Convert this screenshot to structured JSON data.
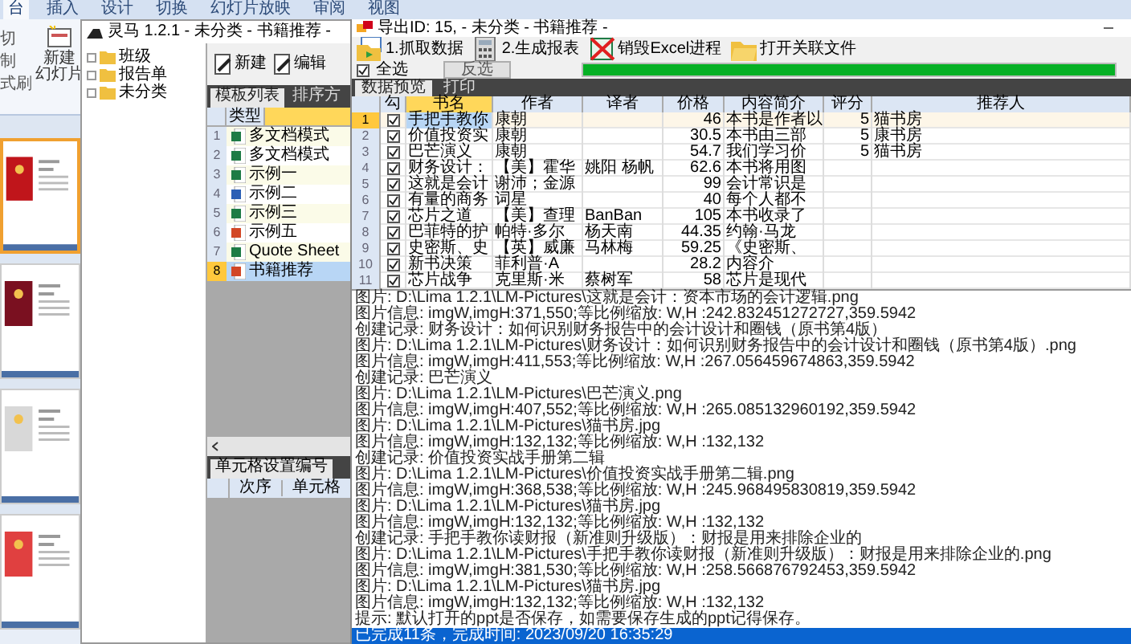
{
  "background_app": {
    "tabs": [
      {
        "label": "台",
        "selected": true
      },
      {
        "label": "插入",
        "selected": false
      },
      {
        "label": "设计",
        "selected": false
      },
      {
        "label": "切换",
        "selected": false
      },
      {
        "label": "幻灯片放映",
        "selected": false
      },
      {
        "label": "审阅",
        "selected": false
      },
      {
        "label": "视图",
        "selected": false
      }
    ],
    "clipboard": [
      "切",
      "制",
      "式刷"
    ],
    "new_slide": [
      "新建",
      "幻灯片"
    ],
    "slides": [
      {
        "kind": "picture",
        "selected": true
      },
      {
        "kind": "picture",
        "selected": false
      },
      {
        "kind": "picture",
        "selected": false
      },
      {
        "kind": "picture",
        "selected": false
      }
    ]
  },
  "main_window": {
    "title": "灵马 1.2.1 - 未分类 - 书籍推荐 -",
    "tree": [
      {
        "label": "班级"
      },
      {
        "label": "报告单"
      },
      {
        "label": "未分类"
      }
    ],
    "toolbar": [
      "新建",
      "编辑"
    ],
    "tabs": [
      {
        "label": "模板列表",
        "selected": true
      },
      {
        "label": "排序方",
        "selected": false
      }
    ],
    "templates": {
      "columns": [
        "类型"
      ],
      "rows": [
        {
          "number": "1",
          "kind": "excel",
          "name": "多文档模式",
          "selected": false
        },
        {
          "number": "2",
          "kind": "excel",
          "name": "多文档模式",
          "selected": false
        },
        {
          "number": "3",
          "kind": "excel",
          "name": "示例一",
          "selected": false
        },
        {
          "number": "4",
          "kind": "word",
          "name": "示例二",
          "selected": false
        },
        {
          "number": "5",
          "kind": "excel",
          "name": "示例三",
          "selected": false
        },
        {
          "number": "6",
          "kind": "ppt",
          "name": "示例五",
          "selected": false
        },
        {
          "number": "7",
          "kind": "excel",
          "name": "Quote Sheet",
          "selected": false
        },
        {
          "number": "8",
          "kind": "ppt",
          "name": "书籍推荐",
          "selected": true
        }
      ]
    },
    "cell_panel": {
      "tab": "单元格设置编号",
      "columns": [
        "次序",
        "单元格"
      ]
    }
  },
  "export_window": {
    "title": "导出ID: 15, - 未分类 - 书籍推荐 -",
    "toolbar": [
      {
        "kind": "fetch",
        "label": "1.抓取数据"
      },
      {
        "kind": "report",
        "label": "2.生成报表"
      },
      {
        "kind": "kill",
        "label": "销毁Excel进程"
      },
      {
        "kind": "folder",
        "label": "打开关联文件"
      }
    ],
    "select_all": {
      "label": "全选",
      "checked": true
    },
    "invert_button": "反选",
    "progress": {
      "level": 1
    },
    "tabs": [
      {
        "label": "数据预览",
        "selected": true
      },
      {
        "label": "打印",
        "selected": false
      }
    ],
    "table": {
      "columns": [
        "勾",
        "书名",
        "作者",
        "译者",
        "价格",
        "内容简介",
        "评分",
        "推荐人"
      ],
      "rows": [
        {
          "number": "1",
          "checked": true,
          "selected": true,
          "cells": [
            "",
            "手把手教你",
            "康朝",
            "",
            "46",
            "本书是作者以",
            "5",
            "猫书房"
          ]
        },
        {
          "number": "2",
          "checked": true,
          "selected": false,
          "cells": [
            "",
            "价值投资实",
            "康朝",
            "",
            "30.5",
            "本书由三部",
            "5",
            "康书房"
          ]
        },
        {
          "number": "3",
          "checked": true,
          "selected": false,
          "cells": [
            "",
            "巴芒演义",
            "康朝",
            "",
            "54.7",
            "我们学习价",
            "5",
            "猫书房"
          ]
        },
        {
          "number": "4",
          "checked": true,
          "selected": false,
          "cells": [
            "",
            "财务设计：",
            "【美】霍华",
            "姚阳 杨帆",
            "62.6",
            "本书将用图",
            "",
            ""
          ]
        },
        {
          "number": "5",
          "checked": true,
          "selected": false,
          "cells": [
            "",
            "这就是会计",
            "谢沛；金源",
            "",
            "99",
            "会计常识是",
            "",
            ""
          ]
        },
        {
          "number": "6",
          "checked": true,
          "selected": false,
          "cells": [
            "",
            "有量的商务",
            "词星",
            "",
            "40",
            "每个人都不",
            "",
            ""
          ]
        },
        {
          "number": "7",
          "checked": true,
          "selected": false,
          "cells": [
            "",
            "芯片之道",
            "【美】查理",
            "BanBan",
            "105",
            "本书收录了",
            "",
            ""
          ]
        },
        {
          "number": "8",
          "checked": true,
          "selected": false,
          "cells": [
            "",
            "巴菲特的护",
            "帕特·多尔",
            "杨天南",
            "44.35",
            "约翰·马龙",
            "",
            ""
          ]
        },
        {
          "number": "9",
          "checked": true,
          "selected": false,
          "cells": [
            "",
            "史密斯、史",
            "【英】威廉",
            "马林梅",
            "59.25",
            "《史密斯、",
            "",
            ""
          ]
        },
        {
          "number": "10",
          "checked": true,
          "selected": false,
          "cells": [
            "",
            "新书决策",
            "菲利普·A",
            "",
            "28.2",
            "内容介",
            "",
            ""
          ]
        },
        {
          "number": "11",
          "checked": true,
          "selected": false,
          "cells": [
            "",
            "芯片战争",
            "克里斯·米",
            "蔡树军",
            "58",
            "芯片是现代",
            "",
            ""
          ]
        }
      ]
    },
    "log": [
      "图片: D:\\Lima 1.2.1\\LM-Pictures\\这就是会计：资本市场的会计逻辑.png",
      "图片信息: imgW,imgH:371,550;等比例缩放: W,H :242.832451272727,359.5942",
      "创建记录: 财务设计：如何识别财务报告中的会计设计和圈钱（原书第4版）",
      "图片: D:\\Lima 1.2.1\\LM-Pictures\\财务设计：如何识别财务报告中的会计设计和圈钱（原书第4版）.png",
      "图片信息: imgW,imgH:411,553;等比例缩放: W,H :267.056459674863,359.5942",
      "创建记录: 巴芒演义",
      "图片: D:\\Lima 1.2.1\\LM-Pictures\\巴芒演义.png",
      "图片信息: imgW,imgH:407,552;等比例缩放: W,H :265.085132960192,359.5942",
      "图片: D:\\Lima 1.2.1\\LM-Pictures\\猫书房.jpg",
      "图片信息: imgW,imgH:132,132;等比例缩放: W,H :132,132",
      "创建记录: 价值投资实战手册第二辑",
      "图片: D:\\Lima 1.2.1\\LM-Pictures\\价值投资实战手册第二辑.png",
      "图片信息: imgW,imgH:368,538;等比例缩放: W,H :245.968495830819,359.5942",
      "图片: D:\\Lima 1.2.1\\LM-Pictures\\猫书房.jpg",
      "图片信息: imgW,imgH:132,132;等比例缩放: W,H :132,132",
      "创建记录: 手把手教你读财报（新准则升级版）：财报是用来排除企业的",
      "图片: D:\\Lima 1.2.1\\LM-Pictures\\手把手教你读财报（新准则升级版）：财报是用来排除企业的.png",
      "图片信息: imgW,imgH:381,530;等比例缩放: W,H :258.566876792453,359.5942",
      "图片: D:\\Lima 1.2.1\\LM-Pictures\\猫书房.jpg",
      "图片信息: imgW,imgH:132,132;等比例缩放: W,H :132,132",
      "提示: 默认打开的ppt是否保存，如需要保存生成的ppt记得保存。"
    ],
    "status": "已完成11条，完成时间: 2023/09/20 16:35:29"
  }
}
